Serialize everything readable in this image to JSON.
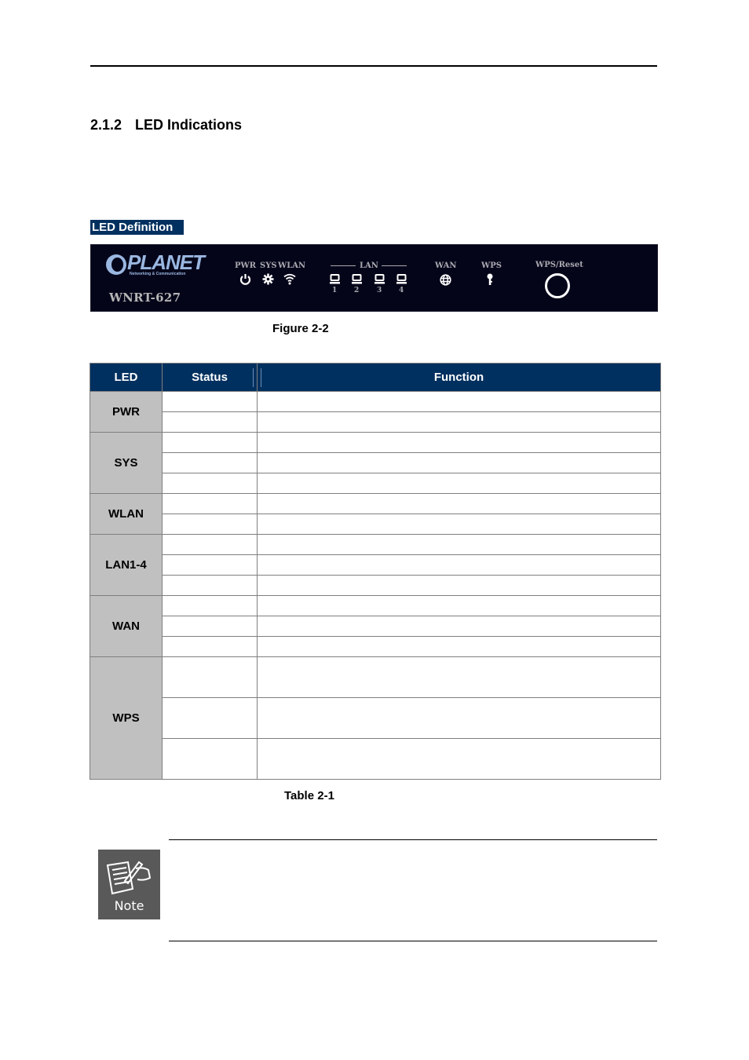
{
  "section": {
    "number": "2.1.2",
    "title": "LED Indications"
  },
  "led_definition_label": "LED Definition",
  "router_panel": {
    "brand": "PLANET",
    "brand_tagline": "Networking & Communication",
    "model": "WNRT-627",
    "indicators": [
      {
        "label": "PWR",
        "icon": "power-icon"
      },
      {
        "label": "SYS",
        "icon": "gear-icon"
      },
      {
        "label": "WLAN",
        "icon": "wifi-icon"
      },
      {
        "label": "LAN",
        "icon": "lan-port-icon",
        "ports": [
          "1",
          "2",
          "3",
          "4"
        ]
      },
      {
        "label": "WAN",
        "icon": "globe-icon"
      },
      {
        "label": "WPS",
        "icon": "key-icon"
      },
      {
        "label": "WPS/Reset",
        "icon": "button-circle-icon"
      }
    ]
  },
  "figure_caption": "Figure 2-2",
  "table": {
    "headers": [
      "LED",
      "Status",
      "Function"
    ],
    "groups": [
      {
        "led": "PWR",
        "rows": 2
      },
      {
        "led": "SYS",
        "rows": 3
      },
      {
        "led": "WLAN",
        "rows": 2
      },
      {
        "led": "LAN1-4",
        "rows": 3
      },
      {
        "led": "WAN",
        "rows": 3
      },
      {
        "led": "WPS",
        "rows": 3
      }
    ],
    "caption": "Table 2-1"
  },
  "note": {
    "label": "Note"
  },
  "colors": {
    "header_bg": "#00305f",
    "led_cell_bg": "#c0c0c0",
    "panel_bg": "#05051a",
    "note_bg": "#595959"
  }
}
